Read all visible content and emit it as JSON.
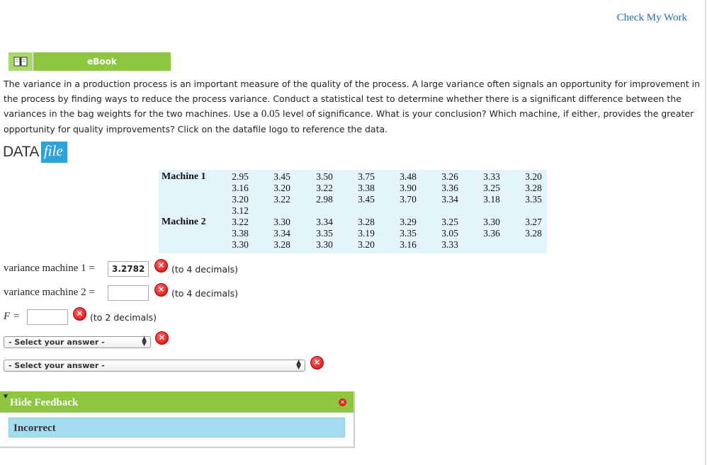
{
  "header": {
    "check_work": "Check My Work"
  },
  "ebook": {
    "label": "eBook"
  },
  "question": {
    "text_before": "The variance in a production process is an important measure of the quality of the process. A large variance often signals an opportunity for improvement in the process by finding ways to reduce the process variance. Conduct a statistical test to determine whether there is a significant difference between the variances in the bag weights for the two machines. Use a ",
    "significance": "0.05",
    "text_after": " level of significance. What is your conclusion? Which machine, if either, provides the greater opportunity for quality improvements? Click on the datafile logo to reference the data."
  },
  "datafile": {
    "part1": "DATA",
    "part2": "file"
  },
  "table": {
    "machine1_label": "Machine 1",
    "machine2_label": "Machine 2",
    "machine1_rows": [
      [
        "2.95",
        "3.45",
        "3.50",
        "3.75",
        "3.48",
        "3.26",
        "3.33",
        "3.20"
      ],
      [
        "3.16",
        "3.20",
        "3.22",
        "3.38",
        "3.90",
        "3.36",
        "3.25",
        "3.28"
      ],
      [
        "3.20",
        "3.22",
        "2.98",
        "3.45",
        "3.70",
        "3.34",
        "3.18",
        "3.35"
      ],
      [
        "3.12",
        "",
        "",
        "",
        "",
        "",
        "",
        ""
      ]
    ],
    "machine2_rows": [
      [
        "3.22",
        "3.30",
        "3.34",
        "3.28",
        "3.29",
        "3.25",
        "3.30",
        "3.27"
      ],
      [
        "3.38",
        "3.34",
        "3.35",
        "3.19",
        "3.35",
        "3.05",
        "3.36",
        "3.28"
      ],
      [
        "3.30",
        "3.28",
        "3.30",
        "3.20",
        "3.16",
        "3.33",
        "",
        ""
      ]
    ]
  },
  "answers": {
    "var1_label": "variance machine 1 =",
    "var1_value": "3.2782",
    "var1_hint": "(to 4 decimals)",
    "var2_label": "variance machine 2 =",
    "var2_value": "",
    "var2_hint": "(to 4 decimals)",
    "f_label": "F =",
    "f_value": "",
    "f_hint": "(to 2 decimals)",
    "select1": "- Select your answer -",
    "select2": "- Select your answer -",
    "wrong_mark": "✕"
  },
  "feedback": {
    "toggle_label": "Hide Feedback",
    "status": "Incorrect"
  }
}
